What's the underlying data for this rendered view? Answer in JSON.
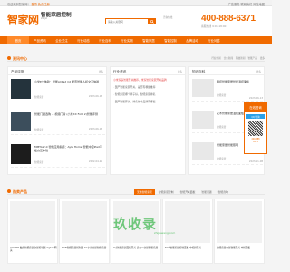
{
  "topbar": {
    "welcome_prefix": "欢迎来到智家网！",
    "login": "登录",
    "register": "免费注册",
    "right_links": "广告服务   联系我们   网站地图"
  },
  "header": {
    "logo": "智家网",
    "tagline": "智能家居控制",
    "tagline_sub": "ZHIJIA",
    "search_placeholder": "请输入关键词",
    "hotline_label": "咨询热线",
    "phone": "400-888-6371",
    "phone_sub": "客服热线 9:00-18:00"
  },
  "nav": {
    "items": [
      "首页",
      "产品资讯",
      "企业关注",
      "行业动态",
      "行业百科",
      "行业实测",
      "智能家居",
      "智能控制",
      "品牌活动",
      "行业问答"
    ],
    "active_index": 0
  },
  "news_section": {
    "title": "资讯中心",
    "links": [
      "行业新闻",
      "企业新闻",
      "科技新闻",
      "智能产品",
      "更多"
    ]
  },
  "news_column": {
    "title": "产品评测",
    "more": "更多",
    "items": [
      {
        "title": "小米E七体验：智能AI/Pad C2 能否智能人机交互体验",
        "cat": "智能家居",
        "date": "2023-06-13"
      },
      {
        "title": "智能门锁选购 + 视频门铃 (小米XX Fold 2)智能评测",
        "cat": "智能家居",
        "date": "2023-06-13"
      },
      {
        "title": "MMTA 2.0 智能应用指南：Ayla Home 智能中控iPad平板交互体验",
        "cat": "智能家居",
        "date": "2022-04-21"
      }
    ]
  },
  "faq_column": {
    "title": "行业资讯",
    "more": "更多",
    "items": [
      {
        "text": "小米家庭智能开关推荐，米家智能家居开关品牌",
        "hl": true
      },
      {
        "text": "· 国产智能家居开关，是否有哪些推荐",
        "hl": false
      },
      {
        "text": "· 智能家居哪个牌子好，智能家居排名",
        "hl": false
      },
      {
        "text": "· 国产智能开关，排名前十品牌有哪些",
        "hl": false
      }
    ]
  },
  "know_column": {
    "title": "知识百科",
    "more": "更多",
    "items": [
      {
        "title": "温控智能家居智能温控面板",
        "cat": "智能家居",
        "date": "2023-06-13"
      },
      {
        "title": "艾木智能家居温控面板",
        "cat": "智能家居",
        "date": "2023-06-13"
      },
      {
        "title": "智能家居智能照明",
        "cat": "智能家居",
        "date": "2023-11-08"
      }
    ]
  },
  "float": {
    "title": "在线咨询",
    "qq": "QQ咨询",
    "phone": "400-888",
    "phone2": "6371"
  },
  "hot_section": {
    "title": "热卖产品",
    "tabs": [
      "无线智能家居",
      "智能家居控制",
      "智能开关面板",
      "智能门锁",
      "智能音响"
    ]
  },
  "products": [
    {
      "name": "LKG700 触摸智能家居全屋控制器 zigbee网关"
    },
    {
      "name": "DGN智能家居控制器 4G小米全屋智能家居"
    },
    {
      "name": "3寸智能家居面板开关 多合一全屋智能家居"
    },
    {
      "name": "TGN智能家居控制面板 中控屏开关"
    },
    {
      "name": "智能家居全屋智能开关 中控面板"
    }
  ],
  "watermark": {
    "text": "玖收录",
    "sub": "zhijiawang.com"
  }
}
